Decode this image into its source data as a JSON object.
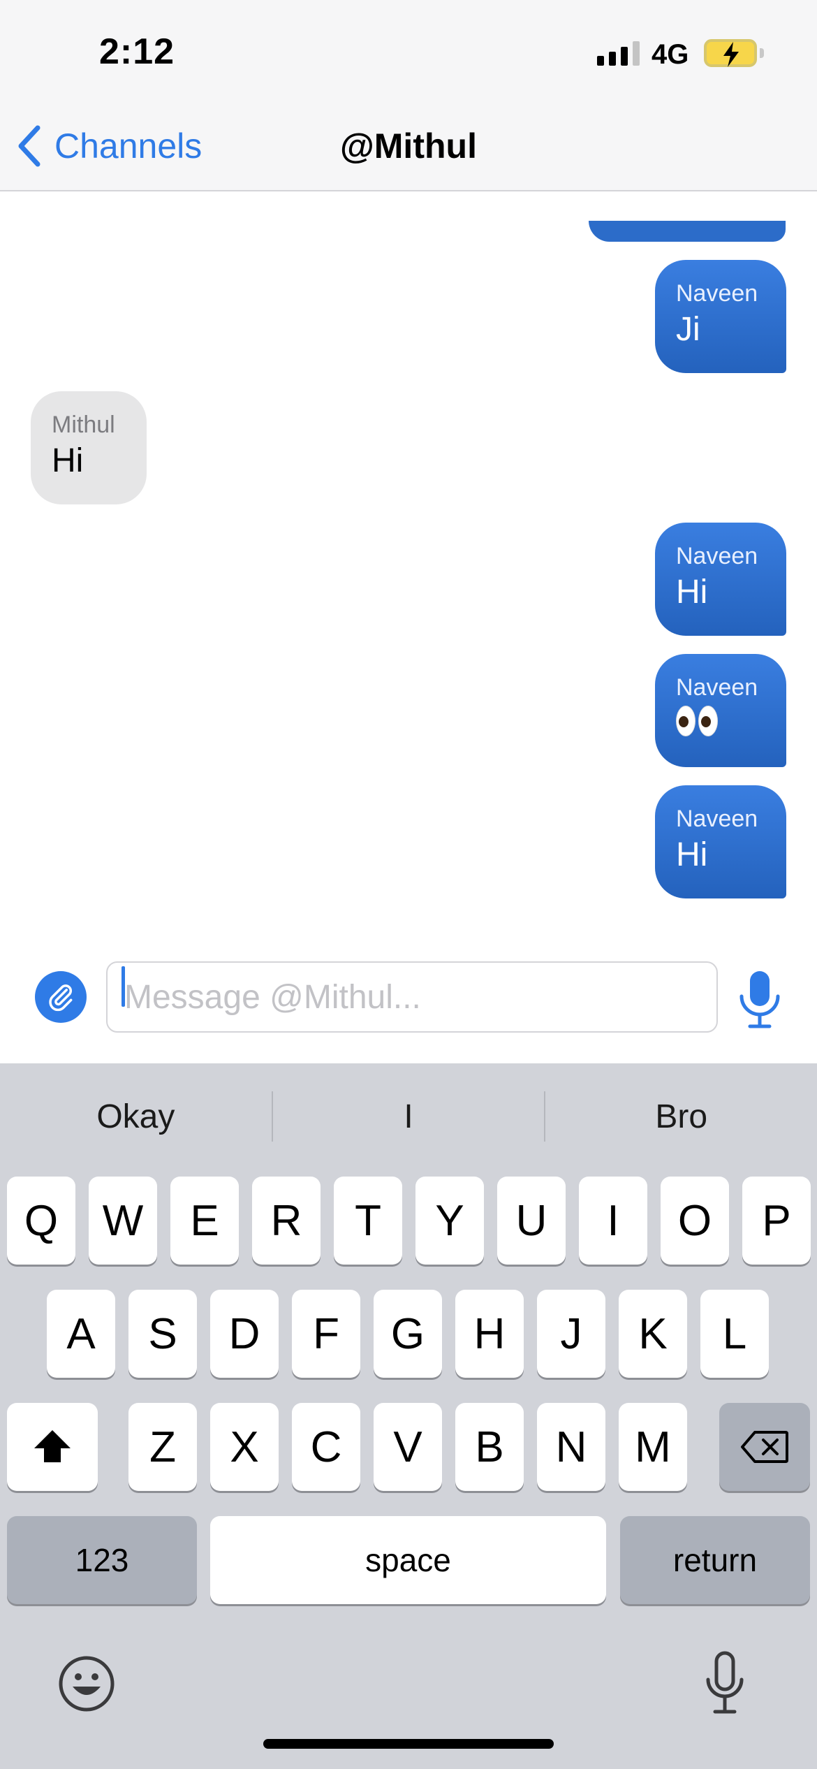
{
  "status_bar": {
    "time": "2:12",
    "network": "4G",
    "signal_bars": 4,
    "battery_charging": true
  },
  "nav": {
    "back_label": "Channels",
    "title": "@Mithul"
  },
  "messages": [
    {
      "sender": "Naveen",
      "text": "Ji",
      "direction": "outgoing"
    },
    {
      "sender": "Mithul",
      "text": "Hi",
      "direction": "incoming"
    },
    {
      "sender": "Naveen",
      "text": "Hi",
      "direction": "outgoing"
    },
    {
      "sender": "Naveen",
      "text": "eyes-emoji",
      "direction": "outgoing"
    },
    {
      "sender": "Naveen",
      "text": "Hi",
      "direction": "outgoing"
    }
  ],
  "composer": {
    "placeholder": "Message @Mithul...",
    "value": ""
  },
  "keyboard": {
    "suggestions": [
      "Okay",
      "I",
      "Bro"
    ],
    "row1": [
      "Q",
      "W",
      "E",
      "R",
      "T",
      "Y",
      "U",
      "I",
      "O",
      "P"
    ],
    "row2": [
      "A",
      "S",
      "D",
      "F",
      "G",
      "H",
      "J",
      "K",
      "L"
    ],
    "row3": [
      "Z",
      "X",
      "C",
      "V",
      "B",
      "N",
      "M"
    ],
    "numbers_label": "123",
    "space_label": "space",
    "return_label": "return"
  },
  "colors": {
    "accent": "#2f7be6",
    "outgoing_bubble": "#2c6cc9",
    "incoming_bubble": "#e6e6e7",
    "keyboard_bg": "#d1d3d9"
  }
}
